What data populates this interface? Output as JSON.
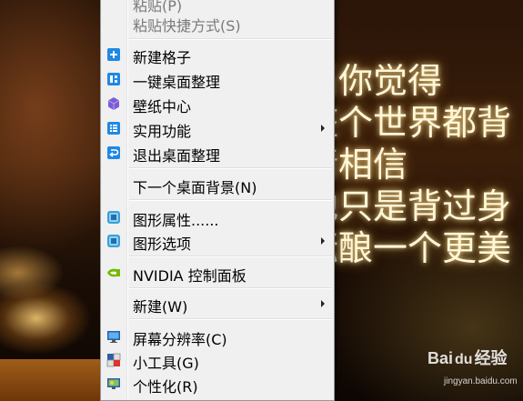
{
  "wallpaper": {
    "lines": [
      "当你觉得",
      "整个世界都背",
      "请相信",
      "他只是背过身",
      "酝酿一个更美"
    ]
  },
  "watermark": {
    "brand": "Bai",
    "brand_suffix": "经验",
    "paw": "du",
    "url": "jingyan.baidu.com"
  },
  "menu": {
    "items": [
      {
        "label": "粘贴(P)",
        "icon": "none",
        "enabled": false
      },
      {
        "label": "粘贴快捷方式(S)",
        "icon": "none",
        "enabled": false
      },
      {
        "label": "新建格子",
        "icon": "blue-plus-icon",
        "enabled": true
      },
      {
        "label": "一键桌面整理",
        "icon": "layout-icon",
        "enabled": true
      },
      {
        "label": "壁纸中心",
        "icon": "purple-cube-icon",
        "enabled": true
      },
      {
        "label": "实用功能",
        "icon": "list-icon",
        "enabled": true,
        "submenu": true
      },
      {
        "label": "退出桌面整理",
        "icon": "exit-icon",
        "enabled": true
      },
      {
        "label": "下一个桌面背景(N)",
        "icon": "none",
        "enabled": true
      },
      {
        "label": "图形属性......",
        "icon": "intel-graphics-icon",
        "enabled": true
      },
      {
        "label": "图形选项",
        "icon": "intel-graphics-icon",
        "enabled": true,
        "submenu": true
      },
      {
        "label": "NVIDIA 控制面板",
        "icon": "nvidia-icon",
        "enabled": true
      },
      {
        "label": "新建(W)",
        "icon": "none",
        "enabled": true,
        "submenu": true
      },
      {
        "label": "屏幕分辨率(C)",
        "icon": "monitor-icon",
        "enabled": true
      },
      {
        "label": "小工具(G)",
        "icon": "gadgets-icon",
        "enabled": true
      },
      {
        "label": "个性化(R)",
        "icon": "personalize-icon",
        "enabled": true
      }
    ]
  },
  "colors": {
    "menu_bg": "#f0f0f0",
    "accent_blue": "#1e88e5",
    "purple": "#7b5cd6",
    "nvidia_green": "#76b900",
    "disabled_text": "#7a7a7a"
  }
}
